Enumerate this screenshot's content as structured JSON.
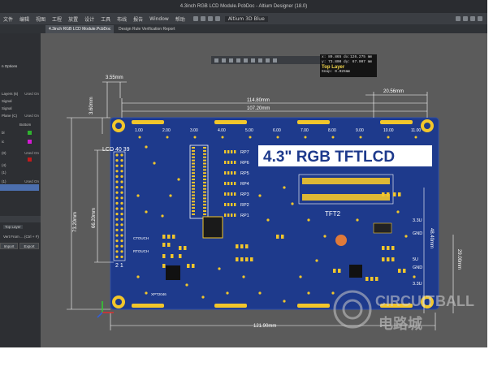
{
  "window": {
    "title": "4.3inch RGB LCD Module.PcbDoc - Altium Designer (18.0)",
    "theme_name": "Altium 3D Blue"
  },
  "menu": [
    "文件",
    "编辑",
    "视图",
    "工程",
    "放置",
    "设计",
    "工具",
    "布线",
    "报告",
    "Window",
    "帮助"
  ],
  "tabs": [
    {
      "label": "4.3inch RGB LCD Module.PcbDoc",
      "active": true
    },
    {
      "label": "Design Rule Verification Report",
      "active": false
    }
  ],
  "left_panel": {
    "header": "n Options",
    "rows": [
      {
        "label": "Layers (6)",
        "value": "Used On"
      },
      {
        "label": "Signal",
        "value": ""
      },
      {
        "label": "Signal",
        "value": ""
      },
      {
        "label": "Plane (C)",
        "value": "Used On"
      },
      {
        "label": "Bottom",
        "value": ""
      },
      {
        "label": "bl",
        "value": ""
      },
      {
        "label": "ic",
        "value": ""
      },
      {
        "label": "(0)",
        "value": "Used On"
      },
      {
        "label": "(4)",
        "value": ""
      },
      {
        "label": "(1)",
        "value": ""
      },
      {
        "label": "(1)",
        "value": "Used On"
      }
    ],
    "layer_select": "Top Layer",
    "filter": "Vert From ... (Ctrl + F)",
    "buttons": [
      "Import",
      "Export"
    ]
  },
  "coords": {
    "line1": "x: 89.865   dx:126.275 mm",
    "line2": "y: 73.800   dy: 67.007 mm",
    "layer": "Top Layer",
    "snap": "Snap: 0.025mm"
  },
  "board": {
    "title": "4.3\" RGB  TFTLCD",
    "tft_label": "TFT2",
    "lcd_label": "LCD 40 39",
    "pins_bottom": "2 1",
    "ruler": [
      "1.00",
      "2.00",
      "3.00",
      "4.00",
      "5.00",
      "6.00",
      "7.00",
      "8.00",
      "9.00",
      "10.00",
      "11.00"
    ],
    "rp_labels": [
      "RP7",
      "RP6",
      "RP5",
      "RP4",
      "RP3",
      "RP2",
      "RP1"
    ],
    "right_labels": [
      "3.3U",
      "GND",
      "5U",
      "GND",
      "3.3U"
    ],
    "left_small": [
      "CTOUCH",
      "RTOUCH",
      "XPT2046"
    ],
    "dims": {
      "top_1": "114.80mm",
      "top_2": "107.20mm",
      "corner_left": "3.55mm",
      "corner_right": "20.56mm",
      "side_left": "3.60mm",
      "height_outer": "73.20mm",
      "height_inner": "66.20mm",
      "height_right_1": "48.40mm",
      "height_right_2": "29.00mm",
      "bottom": "121.90mm"
    }
  },
  "watermark": {
    "latin": "CIRCUIT",
    "latin_suffix": "BALL",
    "chinese": "电路城"
  },
  "colors": {
    "board": "#1e3a8c",
    "pad": "#f2c62b",
    "silk": "#ffffff",
    "canvas": "#5b5b5b",
    "dimension": "#ffffff",
    "coord_layer": "#f2d64b"
  }
}
